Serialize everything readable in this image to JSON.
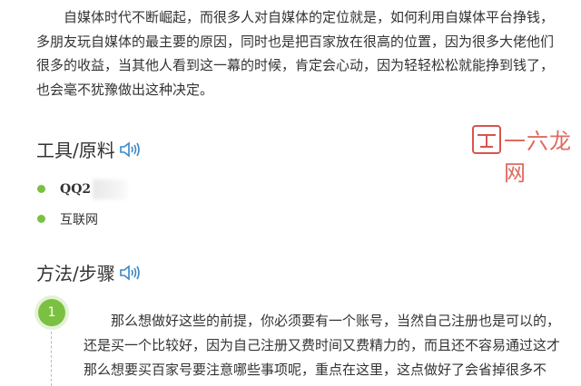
{
  "intro": {
    "lines": [
      "自媒体时代不断崛起，而很多人对自媒体的定位就是，如何利用自媒体平台挣钱，",
      "多朋友玩自媒体的最主要的原因，同时也是把百家放在很高的位置，因为很多大佬他们",
      "很多的收益，当其他人看到这一幕的时候，肯定会心动，因为轻轻松松就能挣到钱了，",
      "也会毫不犹豫做出这种决定。"
    ]
  },
  "tools_section": {
    "title": "工具/原料",
    "items": [
      "QQ2",
      "互联网"
    ]
  },
  "method_section": {
    "title": "方法/步骤"
  },
  "step": {
    "number": "1",
    "lines": [
      "那么想做好这些的前提，你必须要有一个账号，当然自己注册也是可以的，",
      "还是买一个比较好，因为自己注册又费时间又费精力的，而且还不容易通过这才",
      "那么想要买百家号要注意哪些事项呢，重点在这里，这点做好了会省掉很多不"
    ]
  },
  "watermark": {
    "text": "一六龙网"
  },
  "icons": {
    "speaker": "speaker-sound-icon",
    "accent_color": "#7ac142",
    "speaker_color": "#3a87c8"
  }
}
